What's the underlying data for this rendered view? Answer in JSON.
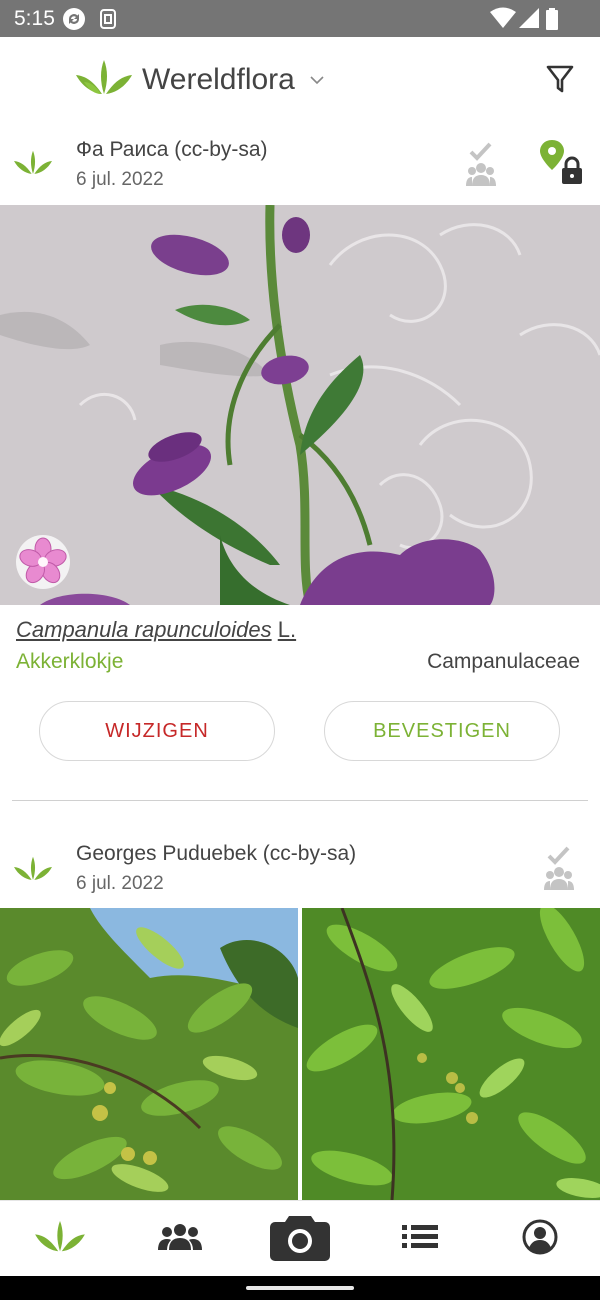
{
  "status_bar": {
    "time": "5:15"
  },
  "app": {
    "title": "Wereldflora"
  },
  "observations": [
    {
      "author": "Фа Раиса (cc-by-sa)",
      "date": "6 jul. 2022",
      "species": {
        "scientific": "Campanula rapunculoides",
        "authority": "L.",
        "common": "Akkerklokje",
        "family": "Campanulaceae"
      },
      "actions": {
        "change_label": "WIJZIGEN",
        "confirm_label": "BEVESTIGEN"
      }
    },
    {
      "author": "Georges Puduebek (cc-by-sa)",
      "date": "6 jul. 2022"
    }
  ],
  "bottom_nav": {
    "items": [
      "home-icon",
      "community-icon",
      "camera-icon",
      "list-icon",
      "account-icon"
    ]
  },
  "colors": {
    "brand_green": "#7cb235",
    "danger_red": "#c62828",
    "status_bar": "#757575"
  }
}
